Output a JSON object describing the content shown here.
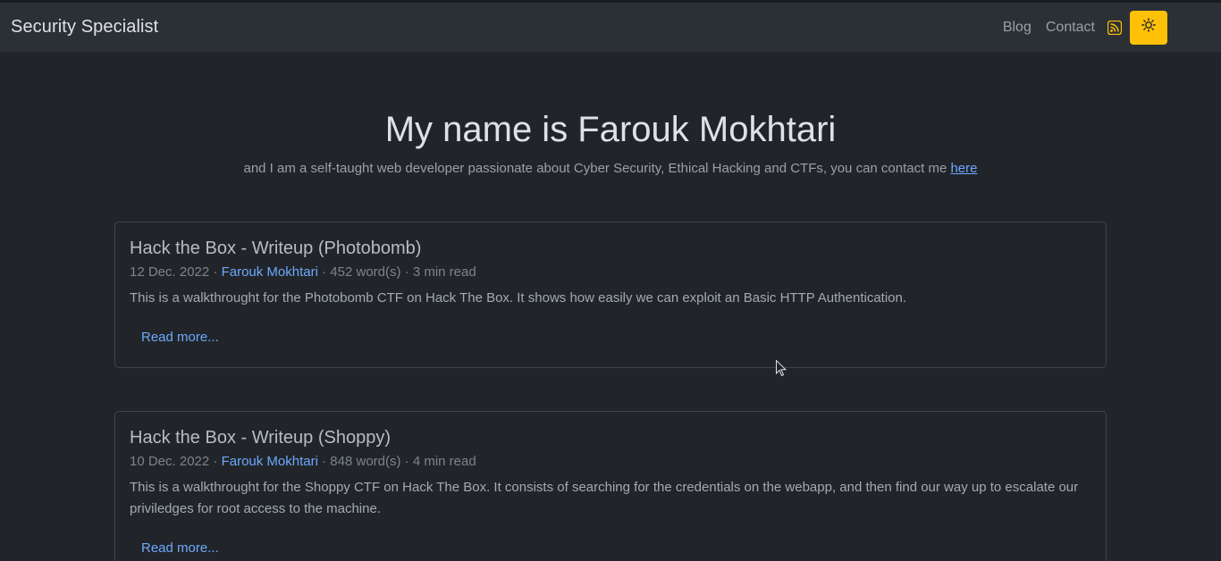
{
  "header": {
    "brand": "Security Specialist",
    "nav": [
      "Blog",
      "Contact"
    ],
    "rss_icon": "rss-icon",
    "theme_icon": "sun-icon",
    "accent": "#ffc107"
  },
  "hero": {
    "title": "My name is Farouk Mokhtari",
    "subtitle": "and I am a self-taught web developer passionate about Cyber Security, Ethical Hacking and CTFs, you can contact me ",
    "link": "here"
  },
  "posts": [
    {
      "title": "Hack the Box - Writeup (Photobomb)",
      "date": "12 Dec. 2022",
      "author": "Farouk Mokhtari",
      "stats": "452 word(s) · 3 min read",
      "excerpt": "This is a walkthrought for the Photobomb CTF on Hack The Box. It shows how easily we can exploit an Basic HTTP Authentication.",
      "read_more": "Read more..."
    },
    {
      "title": "Hack the Box - Writeup (Shoppy)",
      "date": "10 Dec. 2022",
      "author": "Farouk Mokhtari",
      "stats": "848 word(s) · 4 min read",
      "excerpt": "This is a walkthrought for the Shoppy CTF on Hack The Box. It consists of searching for the credentials on the webapp, and then find our way up to escalate our priviledges for root access to the machine.",
      "read_more": "Read more..."
    }
  ]
}
